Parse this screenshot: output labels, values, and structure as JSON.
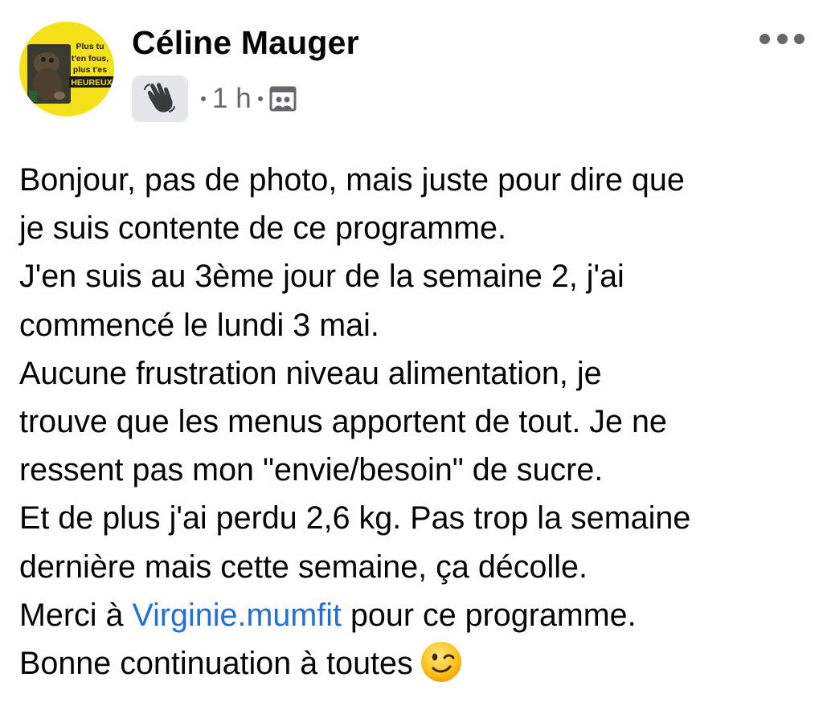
{
  "post": {
    "author": {
      "name": "Céline Mauger",
      "avatar_text": [
        "Plus tu",
        "t'en fous,",
        "plus t'es",
        "HEUREUX"
      ],
      "avatar_bg": "#f5e11a"
    },
    "meta": {
      "badge_icon": "waving-hand-icon",
      "time": "1 h",
      "audience_icon": "photo-album-icon"
    },
    "more_icon": "more-options-icon",
    "body": {
      "line1": "Bonjour, pas de photo, mais juste pour dire que",
      "line2": "je suis contente de ce programme.",
      "line3": "J'en suis au 3ème jour de la semaine 2, j'ai",
      "line4": "commencé le lundi 3 mai.",
      "line5": "Aucune frustration niveau alimentation, je",
      "line6": "trouve que les menus apportent de tout. Je ne",
      "line7": "ressent pas mon \"envie/besoin\" de sucre.",
      "line8": "Et de plus j'ai perdu 2,6 kg. Pas trop la semaine",
      "line9": "dernière mais cette semaine, ça décolle.",
      "line10_prefix": "Merci à ",
      "mention": "Virginie.mumfit",
      "line10_suffix": " pour ce programme.",
      "line11": "Bonne continuation à toutes",
      "closing_emoji": "winking-face-emoji"
    },
    "colors": {
      "text": "#050505",
      "secondary_text": "#65676b",
      "link": "#216fdb",
      "badge_bg": "#e4e6eb"
    }
  }
}
